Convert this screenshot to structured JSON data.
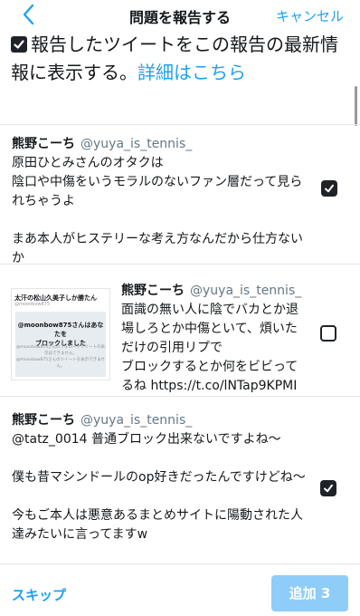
{
  "nav": {
    "title": "問題を報告する",
    "cancel_label": "キャンセル"
  },
  "notice": {
    "checked": true,
    "text": "報告したツイートをこの報告の最新情報に表示する。",
    "link": "詳細はこちら"
  },
  "tweets": [
    {
      "name": "熊野こーち",
      "handle": "@yuya_is_tennis_",
      "body": "原田ひとみさんのオタクは\n陰口や中傷をいうモラルのないファン層だって見られちゃうよ\n\nまあ本人がヒステリーな考え方なんだから仕方ないか",
      "checked": true
    },
    {
      "name": "熊野こーち",
      "handle": "@yuya_is_tennis_",
      "body": "面識の無い人に陰でバカとか退場しろとか中傷といて、煩いただけの引用リプで\nブロックするとか何をビビってるね https://t.co/lNTap9KPMI",
      "checked": false,
      "media": {
        "title": "太汗の松山久美子しか勝たん",
        "subtitle": "@moonbow875",
        "headline": "@moonbow875さんはあなたを\nブロックしました",
        "note": "@moonbow875さんのフォローやツイートの表示はできません。\n@moonbow875さんのツイートを表示できません。"
      }
    },
    {
      "name": "熊野こーち",
      "handle": "@yuya_is_tennis_",
      "body": "@tatz_0014 普通ブロック出来ないですよね〜\n\n僕も昔マシンドールのop好きだったんですけどね〜\n\n今もご本人は悪意あるまとめサイトに陽動された人達みたいに言ってますw",
      "checked": true
    }
  ],
  "bottom": {
    "skip_label": "スキップ",
    "add_label": "追加 3"
  },
  "colors": {
    "accent": "#1da1f2",
    "button_disabled": "#8ecdf8",
    "text": "#14171a",
    "secondary": "#657786",
    "checkbox": "#1f2329"
  }
}
